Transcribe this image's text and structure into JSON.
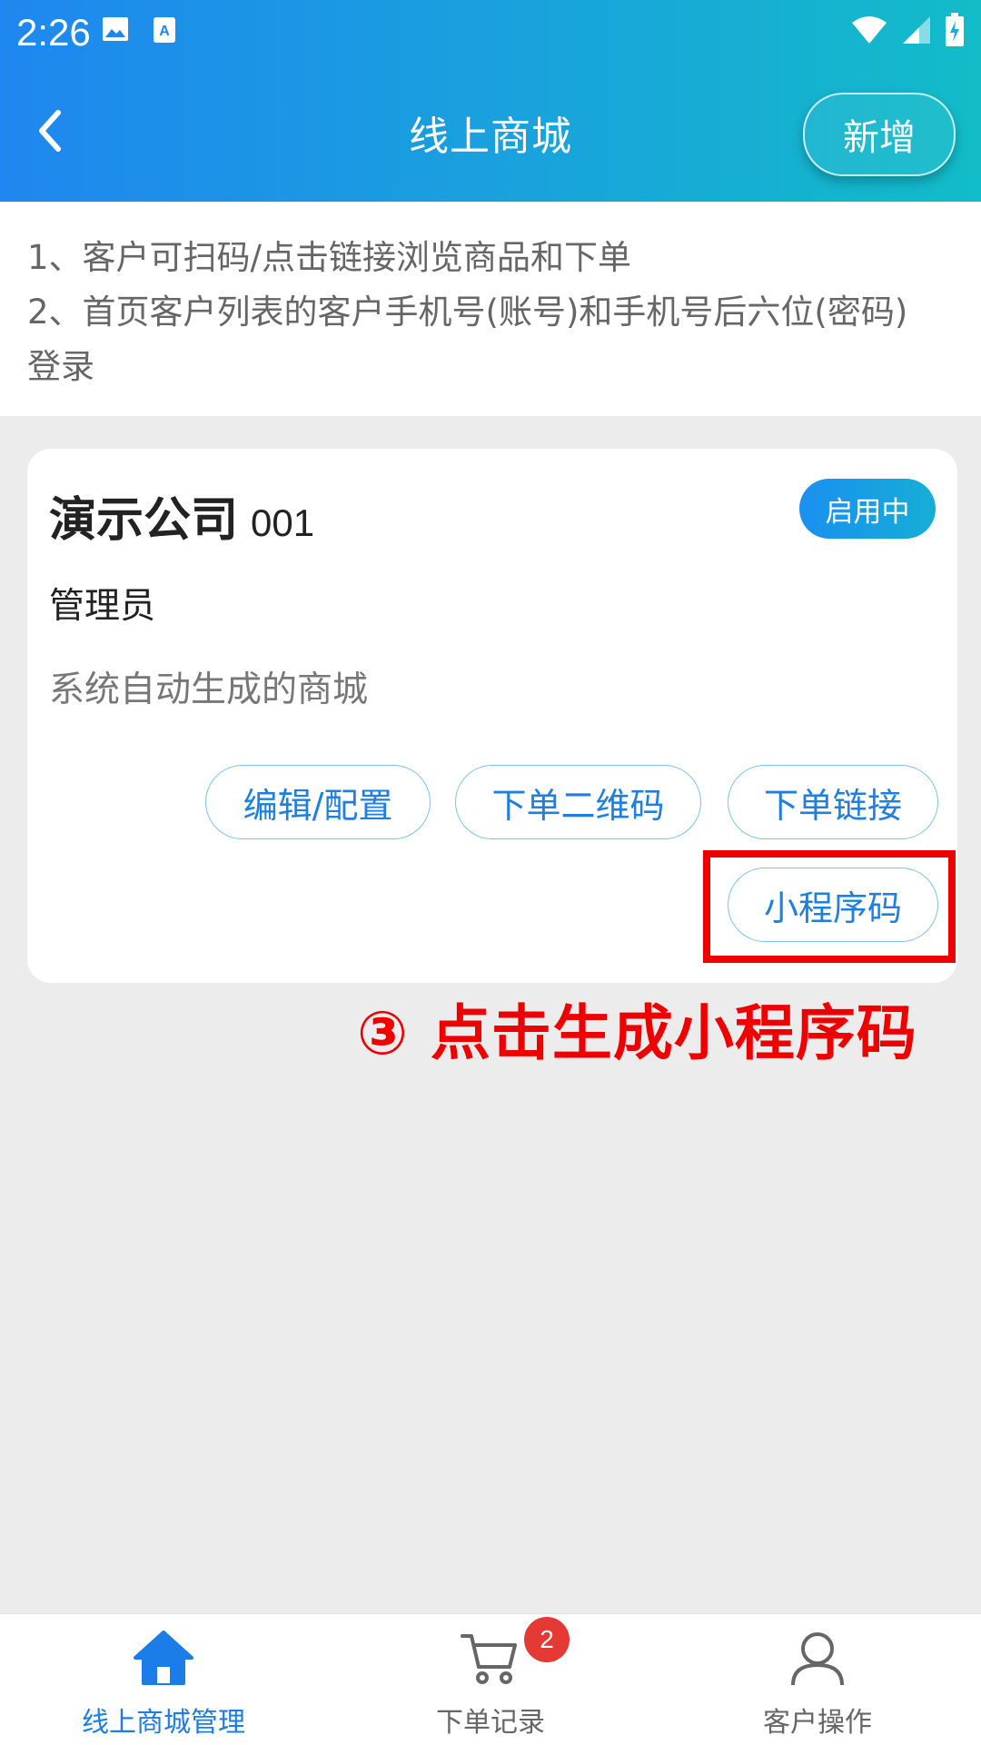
{
  "status_bar": {
    "time": "2:26"
  },
  "header": {
    "title": "线上商城",
    "add_label": "新增"
  },
  "info": {
    "line1": "1、客户可扫码/点击链接浏览商品和下单",
    "line2": "2、首页客户列表的客户手机号(账号)和手机号后六位(密码)登录"
  },
  "card": {
    "company_name": "演示公司",
    "company_code": "001",
    "status": "启用中",
    "role": "管理员",
    "description": "系统自动生成的商城",
    "buttons": {
      "edit": "编辑/配置",
      "qrcode": "下单二维码",
      "link": "下单链接",
      "miniprogram": "小程序码"
    }
  },
  "annotation": "③ 点击生成小程序码",
  "bottom_nav": {
    "items": [
      {
        "label": "线上商城管理",
        "active": true
      },
      {
        "label": "下单记录",
        "badge": "2"
      },
      {
        "label": "客户操作"
      }
    ]
  },
  "colors": {
    "accent": "#1b7ee8",
    "annotation": "#ef0000",
    "badge": "#e53935"
  }
}
